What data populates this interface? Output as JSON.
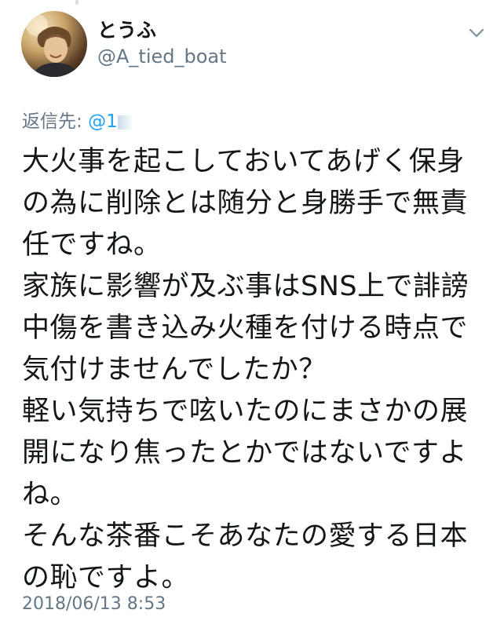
{
  "tweet": {
    "display_name": "とうふ",
    "handle": "@A_tied_boat",
    "reply_label": "返信先:",
    "reply_mention": "@1",
    "body_lines": [
      "大火事を起こしておいてあげく保身",
      "の為に削除とは随分と身勝手で無責",
      "任ですね。",
      "家族に影響が及ぶ事はSNS上で誹謗",
      "中傷を書き込み火種を付ける時点で",
      "気付けませんでしたか？",
      "軽い気持ちで呟いたのにまさかの展",
      "開になり焦ったとかではないですよ",
      "ね。",
      "そんな茶番こそあなたの愛する日本",
      "の恥ですよ。"
    ],
    "timestamp": "2018/06/13 8:53"
  },
  "icons": {
    "menu": "chevron-down-icon",
    "avatar": "avatar"
  },
  "colors": {
    "text": "#14171a",
    "secondary": "#657786",
    "mention": "#1da1f2",
    "chevron": "#8899a6"
  }
}
